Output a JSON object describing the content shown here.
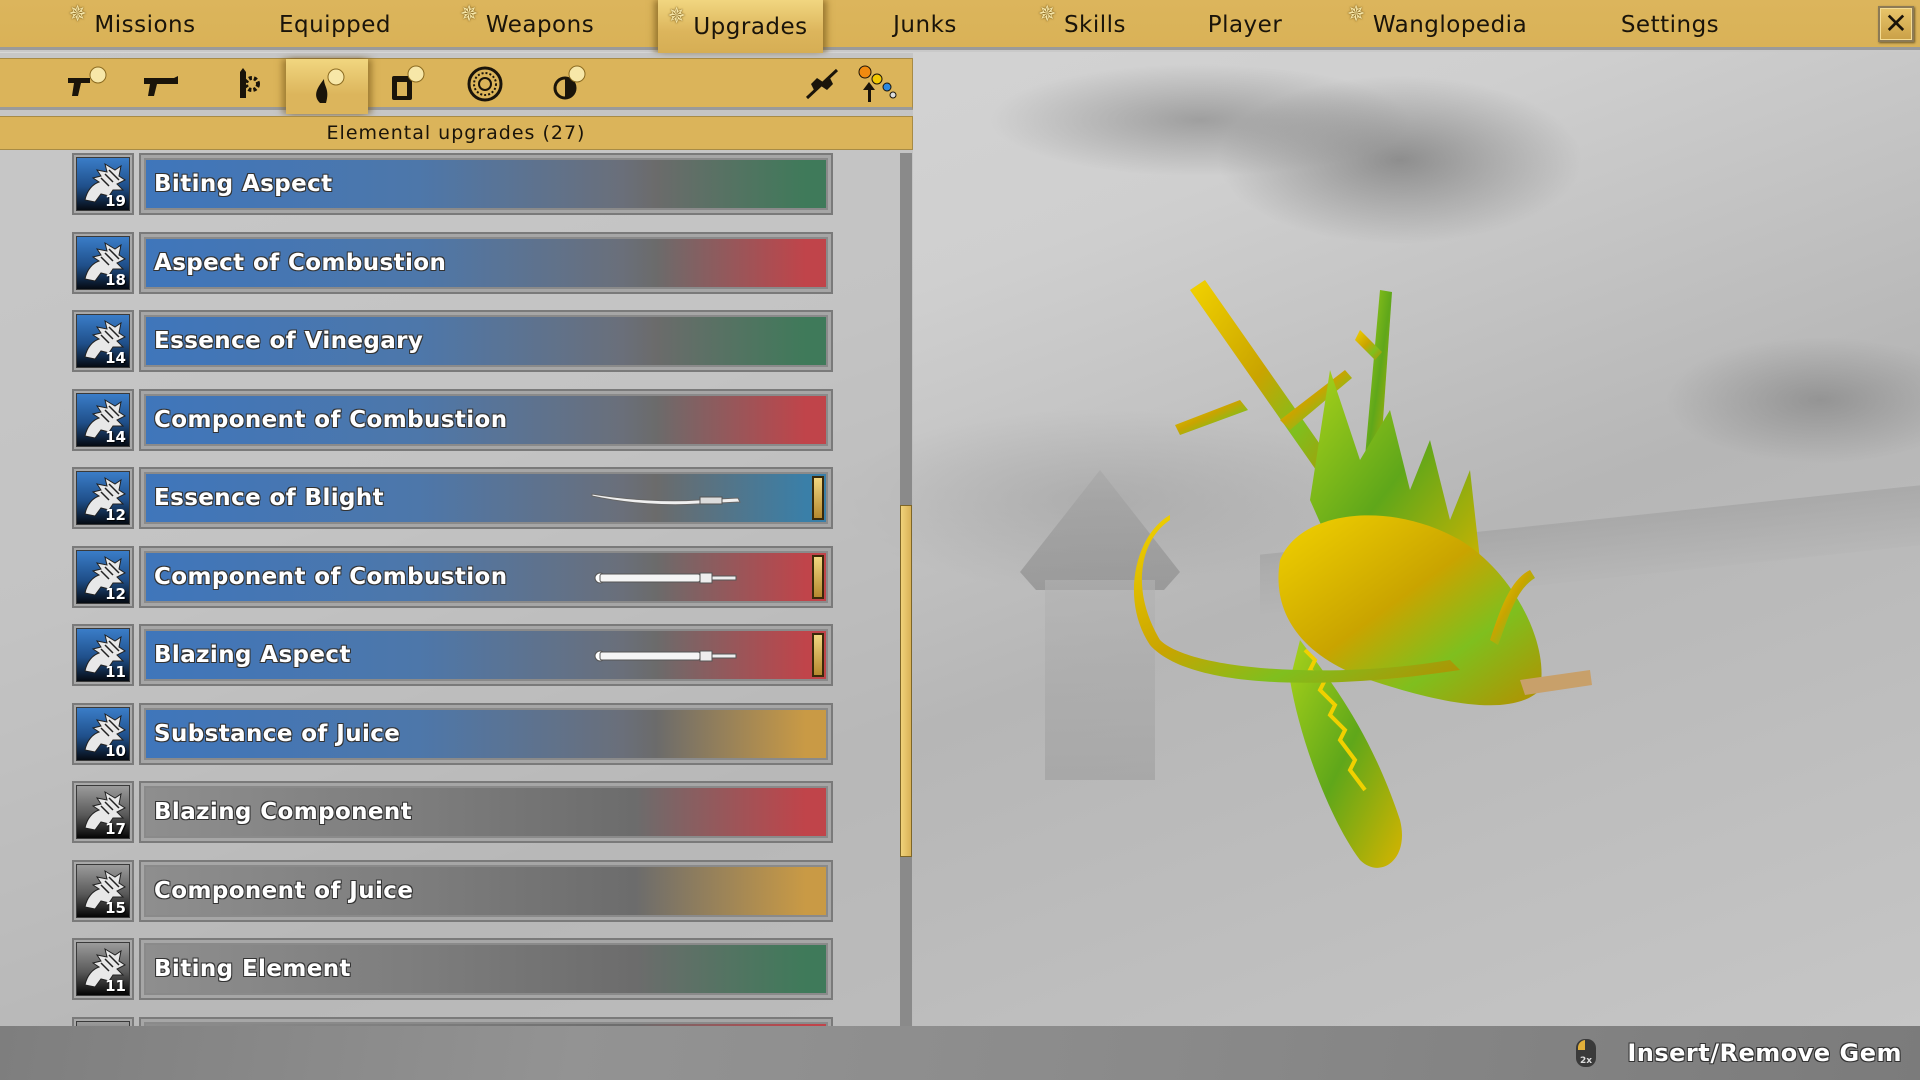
{
  "top_nav": {
    "tabs": [
      {
        "label": "Missions",
        "has_star": true,
        "active": false
      },
      {
        "label": "Equipped",
        "has_star": false,
        "active": false
      },
      {
        "label": "Weapons",
        "has_star": true,
        "active": false
      },
      {
        "label": "Upgrades",
        "has_star": true,
        "active": true
      },
      {
        "label": "Junks",
        "has_star": false,
        "active": false
      },
      {
        "label": "Skills",
        "has_star": true,
        "active": false
      },
      {
        "label": "Player",
        "has_star": false,
        "active": false
      },
      {
        "label": "Wanglopedia",
        "has_star": true,
        "active": false
      },
      {
        "label": "Settings",
        "has_star": false,
        "active": false
      }
    ],
    "close_label": "✕"
  },
  "category_toolbar": {
    "items": [
      {
        "icon": "pistol-star-icon",
        "has_star": true,
        "active": false
      },
      {
        "icon": "pistol-icon",
        "has_star": false,
        "active": false
      },
      {
        "icon": "ammo-gear-icon",
        "has_star": false,
        "active": false
      },
      {
        "icon": "flame-star-icon",
        "has_star": true,
        "active": true
      },
      {
        "icon": "armor-star-icon",
        "has_star": true,
        "active": false
      },
      {
        "icon": "spiral-medallion-icon",
        "has_star": false,
        "active": false
      },
      {
        "icon": "half-circle-star-icon",
        "has_star": true,
        "active": false
      }
    ],
    "right_items": [
      {
        "icon": "no-sparkle-icon"
      },
      {
        "icon": "gem-upgrade-icon"
      }
    ]
  },
  "section": {
    "title": "Elemental upgrades (27)"
  },
  "element_colors": {
    "biting": "#3f7a5a",
    "combustion": "#c0444a",
    "vinegary": "#3f7a5a",
    "blight": "#3a7fa8",
    "juice": "#c99a45"
  },
  "upgrades": [
    {
      "name": "Biting Aspect",
      "level": "19",
      "style": "blue",
      "element": "biting",
      "equipped_weapon": null
    },
    {
      "name": "Aspect of Combustion",
      "level": "18",
      "style": "blue",
      "element": "combustion",
      "equipped_weapon": null
    },
    {
      "name": "Essence of Vinegary",
      "level": "14",
      "style": "blue",
      "element": "vinegary",
      "equipped_weapon": null
    },
    {
      "name": "Component of Combustion",
      "level": "14",
      "style": "blue",
      "element": "combustion",
      "equipped_weapon": null
    },
    {
      "name": "Essence of Blight",
      "level": "12",
      "style": "blue",
      "element": "blight",
      "equipped_weapon": "katana"
    },
    {
      "name": "Component of Combustion",
      "level": "12",
      "style": "blue",
      "element": "combustion",
      "equipped_weapon": "rifle"
    },
    {
      "name": "Blazing Aspect",
      "level": "11",
      "style": "blue",
      "element": "combustion",
      "equipped_weapon": "rifle"
    },
    {
      "name": "Substance of Juice",
      "level": "10",
      "style": "blue",
      "element": "juice",
      "equipped_weapon": null
    },
    {
      "name": "Blazing Component",
      "level": "17",
      "style": "grey",
      "element": "combustion",
      "equipped_weapon": null
    },
    {
      "name": "Component of Juice",
      "level": "15",
      "style": "grey",
      "element": "juice",
      "equipped_weapon": null
    },
    {
      "name": "Biting Element",
      "level": "11",
      "style": "grey",
      "element": "biting",
      "equipped_weapon": null
    },
    {
      "name": "",
      "level": "",
      "style": "grey",
      "element": "combustion",
      "equipped_weapon": "partial"
    }
  ],
  "scroll": {
    "position_fraction": 0.38,
    "visible_fraction": 0.38
  },
  "bottom_bar": {
    "hint_key": "2x",
    "hint_label": "Insert/Remove Gem"
  }
}
